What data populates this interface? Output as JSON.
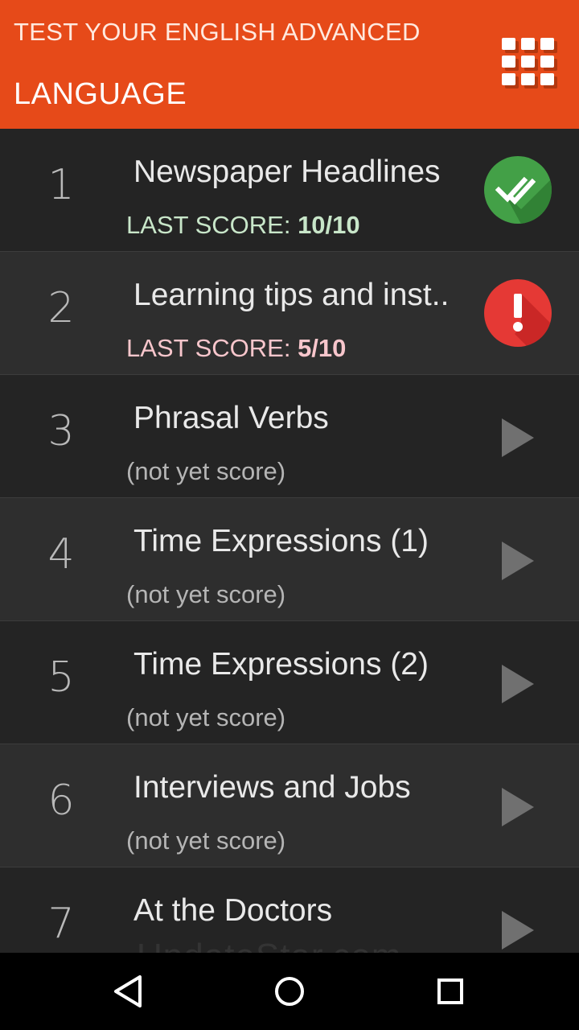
{
  "header": {
    "app_title": "TEST YOUR ENGLISH ADVANCED",
    "section_title": "LANGUAGE",
    "background_color": "#e64a19",
    "menu_icon": "grid-icon"
  },
  "list": {
    "items": [
      {
        "number": "1",
        "title": "Newspaper Headlines",
        "score_label": "LAST SCORE:",
        "score_value": "10/10",
        "status": "passed",
        "status_icon": "double-check-icon",
        "status_color": "#43a047"
      },
      {
        "number": "2",
        "title": "Learning tips and inst..",
        "score_label": "LAST SCORE:",
        "score_value": "5/10",
        "status": "failed",
        "status_icon": "exclamation-icon",
        "status_color": "#e53935"
      },
      {
        "number": "3",
        "title": "Phrasal Verbs",
        "score_label": "(not yet score)",
        "score_value": "",
        "status": "new",
        "status_icon": "play-icon"
      },
      {
        "number": "4",
        "title": "Time Expressions (1)",
        "score_label": "(not yet score)",
        "score_value": "",
        "status": "new",
        "status_icon": "play-icon"
      },
      {
        "number": "5",
        "title": "Time Expressions (2)",
        "score_label": "(not yet score)",
        "score_value": "",
        "status": "new",
        "status_icon": "play-icon"
      },
      {
        "number": "6",
        "title": "Interviews and Jobs",
        "score_label": "(not yet score)",
        "score_value": "",
        "status": "new",
        "status_icon": "play-icon"
      },
      {
        "number": "7",
        "title": "At the Doctors",
        "score_label": "",
        "score_value": "",
        "status": "new",
        "status_icon": "play-icon"
      }
    ]
  },
  "watermark": "UpdateStar.com",
  "navbar": {
    "back_icon": "back-triangle-icon",
    "home_icon": "home-circle-icon",
    "recents_icon": "recents-square-icon"
  }
}
